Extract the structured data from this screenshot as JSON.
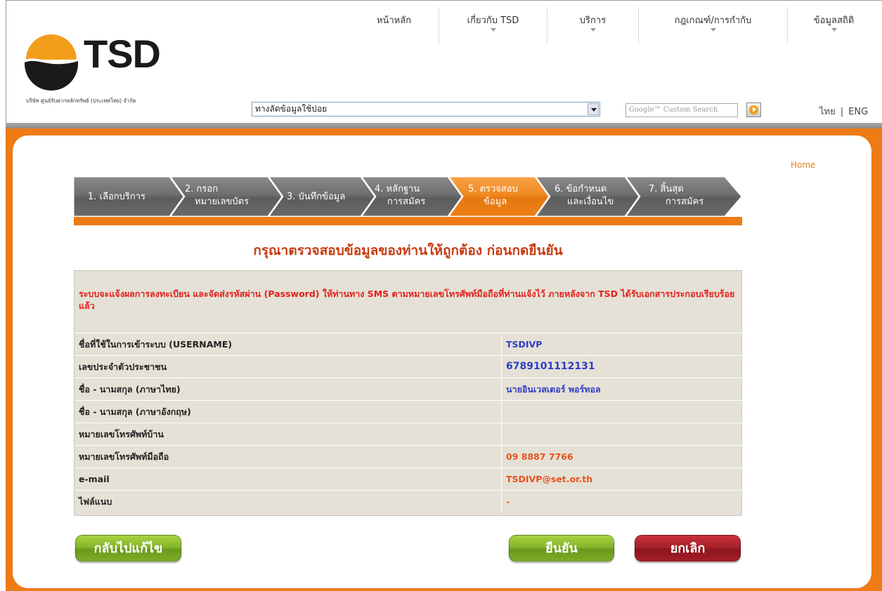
{
  "header": {
    "logo_text": "TSD",
    "company_name": "บริษัท ศูนย์รับฝากหลักทรัพย์ (ประเทศไทย) จำกัด",
    "nav": [
      {
        "label": "หน้าหลัก"
      },
      {
        "label": "เกี่ยวกับ TSD"
      },
      {
        "label": "บริการ"
      },
      {
        "label": "กฎเกณฑ์/การกำกับ"
      },
      {
        "label": "ข้อมูลสถิติ"
      }
    ],
    "quick_select_value": "ทางลัดข้อมูลใช้บ่อย",
    "search_placeholder": "Google™ Custom Search",
    "lang_th": "ไทย",
    "lang_sep": "|",
    "lang_en": "ENG"
  },
  "breadcrumb": {
    "home": "Home"
  },
  "steps": [
    {
      "line1": "1. เลือกบริการ",
      "line2": ""
    },
    {
      "line1": "2. กรอก",
      "line2": "หมายเลขบัตร"
    },
    {
      "line1": "3. บันทึกข้อมูล",
      "line2": ""
    },
    {
      "line1": "4. หลักฐาน",
      "line2": "การสมัคร"
    },
    {
      "line1": "5. ตรวจสอบ",
      "line2": "ข้อมูล"
    },
    {
      "line1": "6. ข้อกำหนด",
      "line2": "และเงื่อนไข"
    },
    {
      "line1": "7. สิ้นสุด",
      "line2": "การสมัคร"
    }
  ],
  "active_step": 5,
  "colors": {
    "orange": "#ee7b14",
    "step_gray": "#6a6a6a",
    "title_red": "#c83b10",
    "notice_red": "#e3211c",
    "value_blue": "#2f3ec7",
    "value_orange": "#e8521a"
  },
  "page_title": "กรุณาตรวจสอบข้อมูลของท่านให้ถูกต้อง ก่อนกดยืนยัน",
  "notice": "ระบบจะแจ้งผลการลงทะเบียน และจัดส่งรหัสผ่าน (Password) ให้ท่านทาง SMS ตามหมายเลขโทรศัพท์มือถือที่ท่านแจ้งไว้ ภายหลังจาก TSD ได้รับเอกสารประกอบเรียบร้อยแล้ว",
  "fields": [
    {
      "label": "ชื่อที่ใช้ในการเข้าระบบ (USERNAME)",
      "value": "TSDIVP"
    },
    {
      "label": "เลขประจำตัวประชาชน",
      "value": "6789101112131"
    },
    {
      "label": "ชื่อ - นามสกุล (ภาษาไทย)",
      "value": "นายอินเวสเตอร์ พอร์ทอล"
    },
    {
      "label": "ชื่อ - นามสกุล (ภาษาอังกฤษ)",
      "value": ""
    },
    {
      "label": "หมายเลขโทรศัพท์บ้าน",
      "value": ""
    },
    {
      "label": "หมายเลขโทรศัพท์มือถือ",
      "value": "09 8887 7766"
    },
    {
      "label": "e-mail",
      "value": "TSDIVP@set.or.th"
    },
    {
      "label": "ไฟล์แนบ",
      "value": "-"
    }
  ],
  "buttons": {
    "back": "กลับไปแก้ไข",
    "confirm": "ยืนยัน",
    "cancel": "ยกเลิก"
  }
}
